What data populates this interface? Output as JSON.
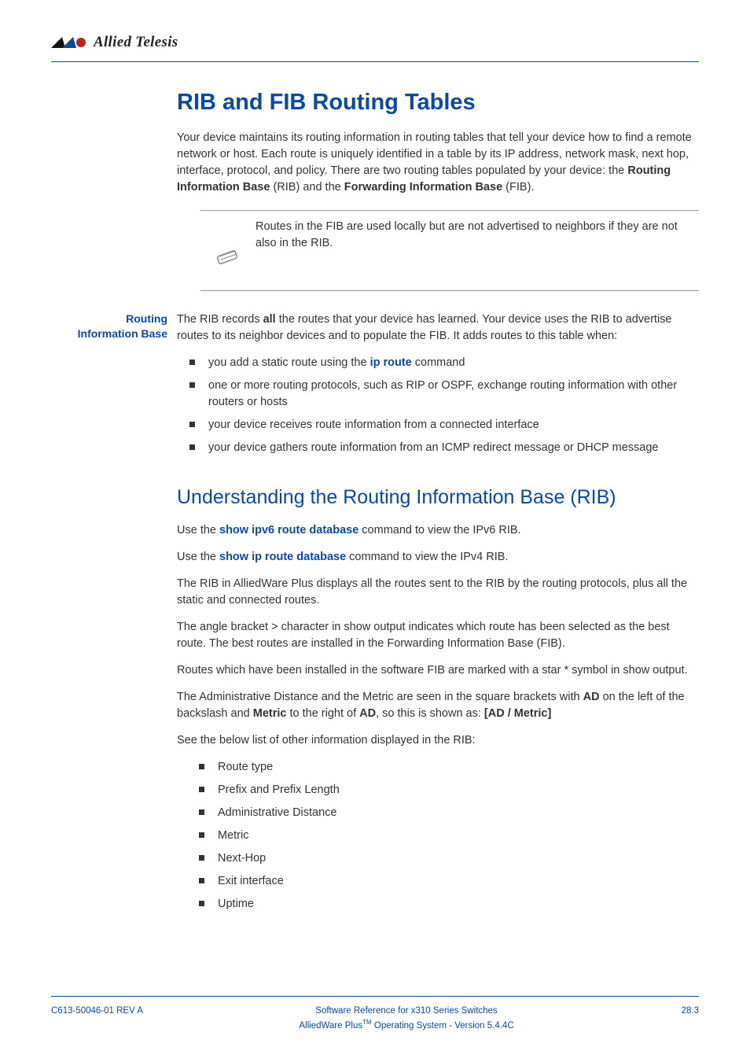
{
  "brand": "Allied Telesis",
  "h1": "RIB and FIB Routing Tables",
  "intro_p1_a": "Your device maintains its routing information in routing tables that tell your device how to find a remote network or host. Each route is uniquely identified in a table by its IP address, network mask, next hop, interface, protocol, and policy. There are two routing tables populated by your device: the ",
  "intro_rib_bold": "Routing Information Base",
  "intro_p1_b": " (RIB) and the ",
  "intro_fib_bold": "Forwarding Information Base",
  "intro_p1_c": " (FIB).",
  "note_text": "Routes in the FIB are used locally but are not advertised to neighbors if they are not also in the RIB.",
  "side_label_1a": "Routing",
  "side_label_1b": "Information Base",
  "rib_p_a": "The RIB records ",
  "rib_all": "all",
  "rib_p_b": " the routes that your device has learned. Your device uses the RIB to advertise routes to its neighbor devices and to populate the FIB. It adds routes to this table when:",
  "bl1a_a": "you add a static route using the ",
  "bl1a_link": "ip route",
  "bl1a_b": " command",
  "bl1b": "one or more routing protocols, such as RIP or OSPF, exchange routing information with other routers or hosts",
  "bl1c": "your device receives route information from a connected interface",
  "bl1d": "your device gathers route information from an ICMP redirect message or DHCP message",
  "h2": "Understanding the Routing Information Base (RIB)",
  "p2a_a": "Use the ",
  "p2a_link": "show ipv6 route database",
  "p2a_b": " command to view the IPv6 RIB.",
  "p2b_a": "Use the ",
  "p2b_link": "show ip route database",
  "p2b_b": " command to view the IPv4 RIB.",
  "p3": "The RIB in AlliedWare Plus displays all the routes sent to the RIB by the routing protocols, plus all the static and connected routes.",
  "p4": "The angle bracket > character in show output indicates which route has been selected as the best route. The best routes are installed in the Forwarding Information Base (FIB).",
  "p5": "Routes which have been installed in the software FIB are marked with a star * symbol in show output.",
  "p6a": "The Administrative Distance and the Metric are seen in the square brackets with ",
  "p6_ad": "AD",
  "p6b": " on the left of the backslash and ",
  "p6_metric": "Metric",
  "p6c": " to the right of ",
  "p6_ad2": "AD",
  "p6d": ", so this is shown as: ",
  "p6_bracket": "[AD / Metric]",
  "p7": "See the below list of other information displayed in the RIB:",
  "bl2": [
    "Route type",
    "Prefix and Prefix Length",
    "Administrative Distance",
    "Metric",
    "Next-Hop",
    "Exit interface",
    "Uptime"
  ],
  "footer_left": "C613-50046-01 REV A",
  "footer_center1": "Software Reference for x310 Series Switches",
  "footer_center2a": "AlliedWare Plus",
  "footer_center2_tm": "TM",
  "footer_center2b": " Operating System - Version 5.4.4C",
  "footer_right": "28.3"
}
